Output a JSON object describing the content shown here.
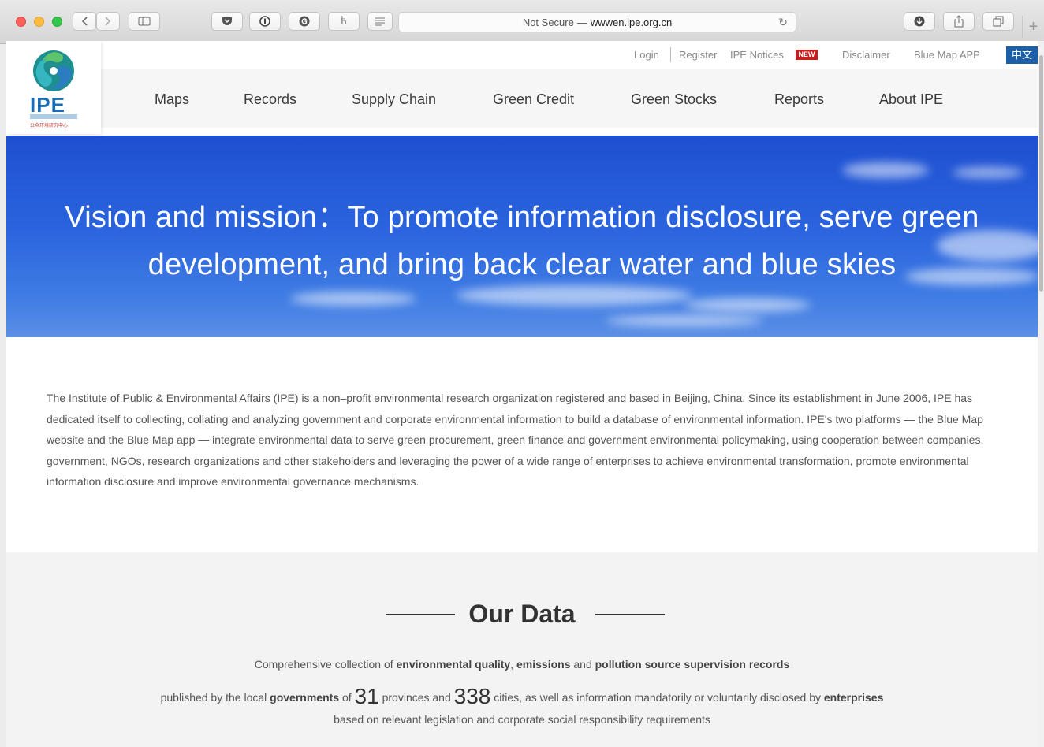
{
  "browser": {
    "address_security": "Not Secure",
    "address_dash": "—",
    "address_host": "wwwen.ipe.org.cn",
    "new_tab_label": "+"
  },
  "logo": {
    "text": "IPE",
    "subtext": "公众环境研究中心"
  },
  "utility_nav": {
    "login": "Login",
    "register": "Register",
    "notices": "IPE Notices",
    "new_badge": "NEW",
    "disclaimer": "Disclaimer",
    "blue_map_app": "Blue Map APP",
    "language": "中文"
  },
  "main_nav": [
    "Maps",
    "Records",
    "Supply Chain",
    "Green Credit",
    "Green Stocks",
    "Reports",
    "About IPE"
  ],
  "hero": {
    "line1": "Vision and mission：To promote information disclosure, serve green",
    "line2": "development, and bring back clear water and blue skies"
  },
  "about": {
    "text": "The Institute of Public & Environmental Affairs (IPE) is a non–profit environmental research organization registered and based in Beijing, China. Since its establishment in June 2006, IPE has dedicated itself to collecting, collating and analyzing government and corporate environmental information to build a database of environmental information. IPE's two platforms — the Blue Map website and the Blue Map app — integrate environmental data to serve green procurement, green finance and government environmental policymaking, using cooperation between companies, government, NGOs, research organizations and other stakeholders and leveraging the power of a wide range of enterprises to achieve environmental transformation, promote environmental information disclosure and improve environmental governance mechanisms."
  },
  "our_data": {
    "title": "Our Data",
    "line1": {
      "p1": "Comprehensive collection of ",
      "b1": "environmental quality",
      "p2": ", ",
      "b2": "emissions",
      "p3": " and ",
      "b3": "pollution source supervision records"
    },
    "line2": {
      "p1": "published by the local ",
      "b1": "governments",
      "p2": " of ",
      "n1": "31",
      "p3": " provinces and ",
      "n2": "338",
      "p4": " cities, as well as information mandatorily or voluntarily disclosed by ",
      "b2": "enterprises"
    },
    "line3": "based on relevant legislation and corporate social responsibility requirements"
  },
  "colors": {
    "brand_blue": "#1c5fa8",
    "new_badge_red": "#c81e1e",
    "hero_blue": "#2a63de"
  }
}
